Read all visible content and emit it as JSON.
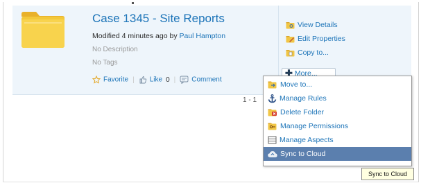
{
  "folder": {
    "title": "Case 1345 - Site Reports",
    "modified_prefix": "Modified 4 minutes ago by",
    "modified_author": "Paul Hampton",
    "description": "No Description",
    "tags": "No Tags",
    "social": {
      "favorite": "Favorite",
      "like": "Like",
      "like_count": "0",
      "comment": "Comment"
    }
  },
  "actions": {
    "view_details": "View Details",
    "edit_properties": "Edit Properties",
    "copy_to": "Copy to...",
    "more": "More..."
  },
  "pager": "1 - 1",
  "menu": {
    "items": [
      {
        "label": "Move to...",
        "icon": "move-folder-icon"
      },
      {
        "label": "Manage Rules",
        "icon": "anchor-icon"
      },
      {
        "label": "Delete Folder",
        "icon": "delete-folder-icon"
      },
      {
        "label": "Manage Permissions",
        "icon": "key-folder-icon"
      },
      {
        "label": "Manage Aspects",
        "icon": "aspects-icon"
      },
      {
        "label": "Sync to Cloud",
        "icon": "cloud-sync-icon"
      }
    ],
    "highlighted": "Sync to Cloud"
  },
  "tooltip": "Sync to Cloud",
  "colors": {
    "link": "#1c74b8",
    "row_background": "#eef5fb",
    "menu_highlight": "#5b7fae",
    "tooltip_background": "#ffffe1"
  }
}
